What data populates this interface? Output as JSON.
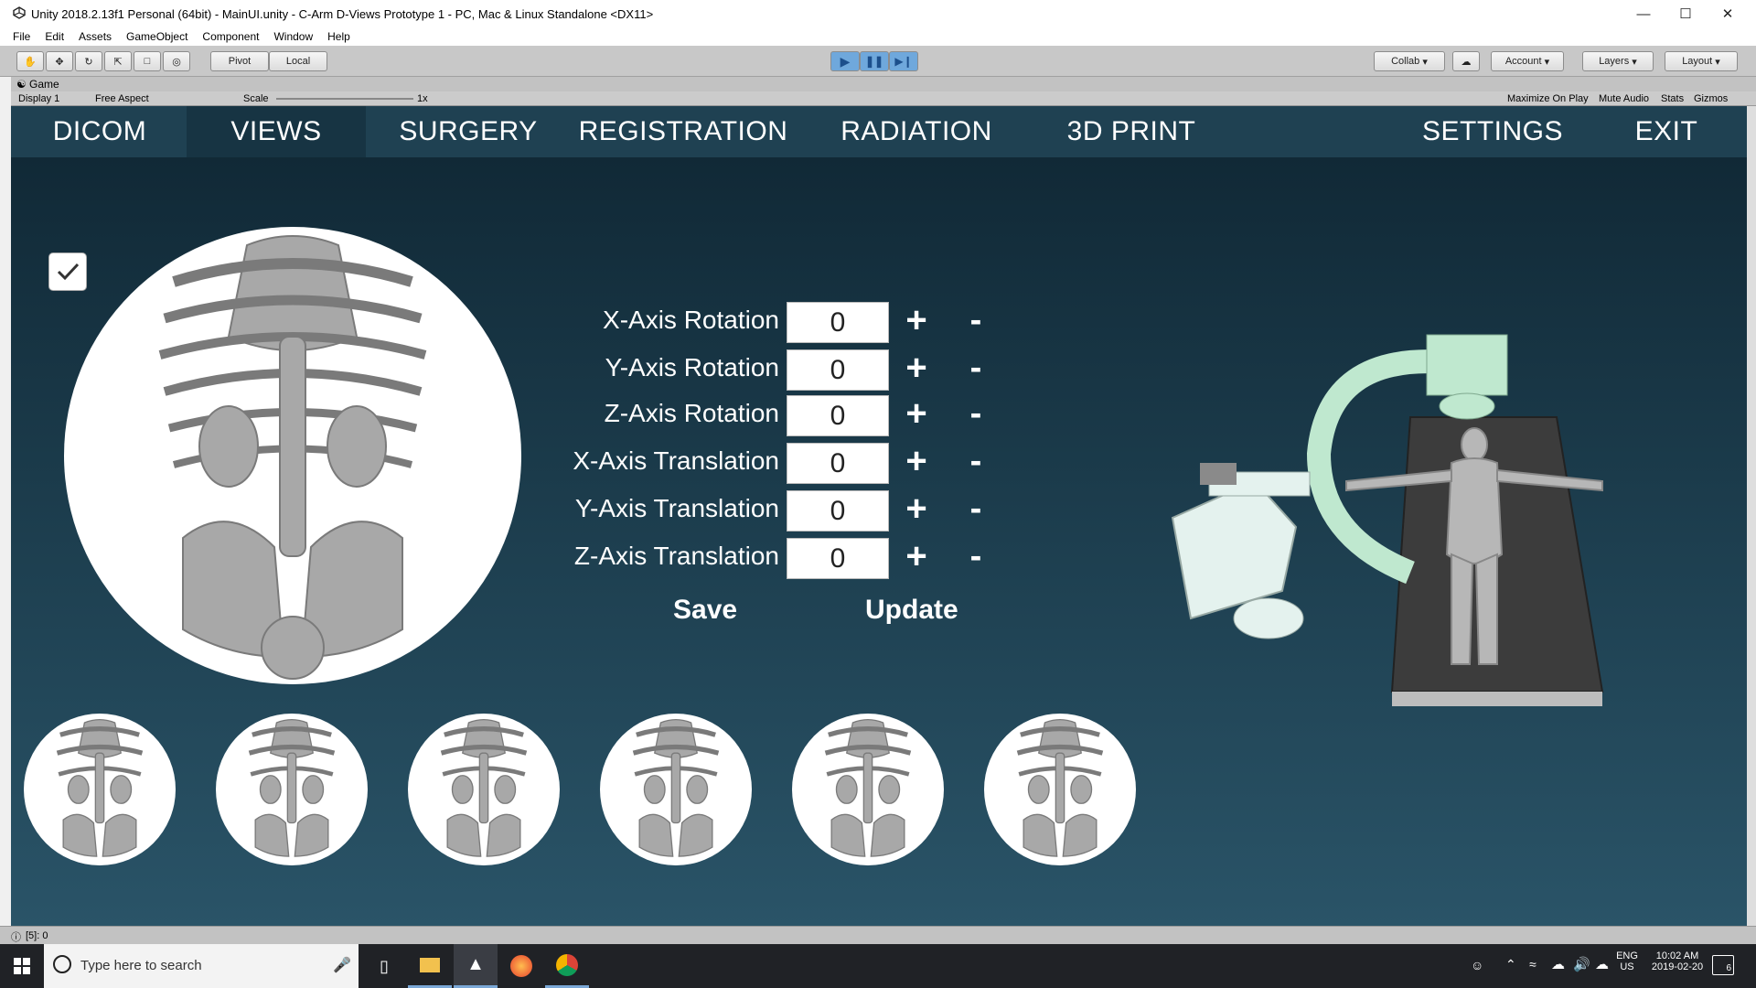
{
  "window": {
    "title": "Unity 2018.2.13f1 Personal (64bit) - MainUI.unity - C-Arm D-Views Prototype 1 - PC, Mac & Linux Standalone <DX11>"
  },
  "menu": [
    "File",
    "Edit",
    "Assets",
    "GameObject",
    "Component",
    "Window",
    "Help"
  ],
  "toolbar": {
    "pivot": "Pivot",
    "local": "Local",
    "collab": "Collab",
    "account": "Account",
    "layers": "Layers",
    "layout": "Layout"
  },
  "game_tab": {
    "label": "Game"
  },
  "game_bar": {
    "display": "Display 1",
    "aspect": "Free Aspect",
    "scale_label": "Scale",
    "scale_value": "1x",
    "maximize": "Maximize On Play",
    "mute": "Mute Audio",
    "stats": "Stats",
    "gizmos": "Gizmos"
  },
  "nav": {
    "dicom": "DICOM",
    "views": "VIEWS",
    "surgery": "SURGERY",
    "registration": "REGISTRATION",
    "radiation": "RADIATION",
    "print3d": "3D PRINT",
    "settings": "SETTINGS",
    "exit": "EXIT"
  },
  "controls": [
    {
      "label": "X-Axis Rotation",
      "value": "0"
    },
    {
      "label": "Y-Axis Rotation",
      "value": "0"
    },
    {
      "label": "Z-Axis Rotation",
      "value": "0"
    },
    {
      "label": "X-Axis Translation",
      "value": "0"
    },
    {
      "label": "Y-Axis Translation",
      "value": "0"
    },
    {
      "label": "Z-Axis Translation",
      "value": "0"
    }
  ],
  "step": {
    "plus": "+",
    "minus": "-"
  },
  "actions": {
    "save": "Save",
    "update": "Update"
  },
  "status": {
    "text": "[5]: 0"
  },
  "taskbar": {
    "search_placeholder": "Type here to search",
    "lang": "ENG",
    "region": "US",
    "time": "10:02 AM",
    "date": "2019-02-20",
    "notifications": "6"
  },
  "colors": {
    "nav_bg": "#1f4152",
    "nav_active": "#173443",
    "carm": "#bfe8cf"
  }
}
